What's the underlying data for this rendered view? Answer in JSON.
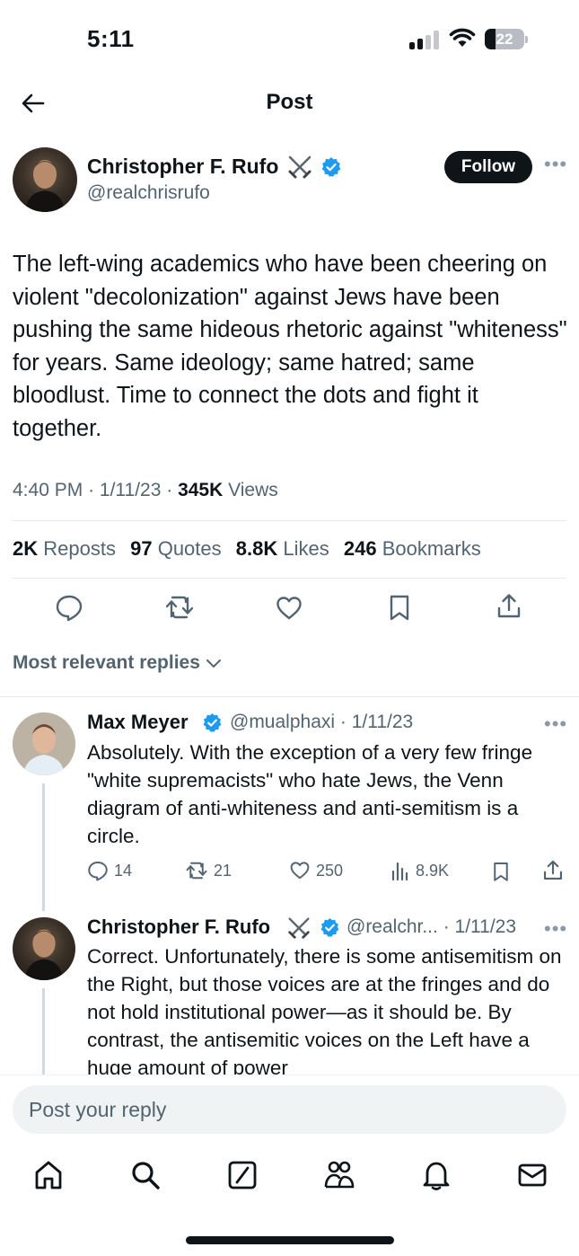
{
  "status_bar": {
    "time": "5:11",
    "battery": "22"
  },
  "header": {
    "title": "Post"
  },
  "post": {
    "author_name": "Christopher F. Rufo",
    "author_handle": "@realchrisrufo",
    "follow_label": "Follow",
    "text": "The left-wing academics who have been cheering on violent \"decolonization\" against Jews have been pushing the same hideous rhetoric against \"whiteness\" for years. Same ideology; same hatred; same bloodlust. Time to connect the dots and fight it together.",
    "time": "4:40 PM",
    "date": "1/11/23",
    "views_count": "345K",
    "views_label": "Views",
    "stats": {
      "reposts_count": "2K",
      "reposts_label": "Reposts",
      "quotes_count": "97",
      "quotes_label": "Quotes",
      "likes_count": "8.8K",
      "likes_label": "Likes",
      "bookmarks_count": "246",
      "bookmarks_label": "Bookmarks"
    }
  },
  "replies_sort": "Most relevant replies",
  "replies": [
    {
      "name": "Max Meyer",
      "handle": "@mualphaxi",
      "date": "1/11/23",
      "text": "Absolutely. With the exception of a very few fringe \"white supremacists\" who hate Jews, the Venn diagram of anti-whiteness and anti-semitism is a circle.",
      "replies": "14",
      "reposts": "21",
      "likes": "250",
      "views": "8.9K"
    },
    {
      "name": "Christopher F. Rufo",
      "handle": "@realchr...",
      "date": "1/11/23",
      "text": "Correct. Unfortunately, there is some antisemitism on the Right, but those voices are at the fringes and do not hold institutional power—as it should be. By contrast, the antisemitic voices on the Left have a huge amount of power"
    }
  ],
  "reply_input": {
    "placeholder": "Post your reply"
  },
  "colors": {
    "verified": "#1d9bf0",
    "text": "#0f1419",
    "secondary": "#536471"
  }
}
